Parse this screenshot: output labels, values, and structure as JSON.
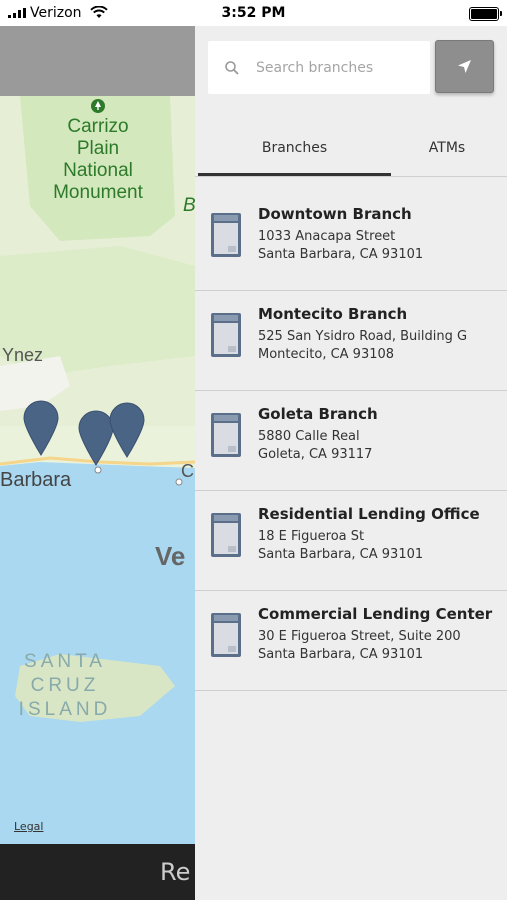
{
  "status_bar": {
    "carrier": "Verizon",
    "time": "3:52 PM"
  },
  "map": {
    "labels": {
      "park": "Carrizo\nPlain\nNational\nMonument",
      "park_edge": "B",
      "ynez": "Ynez",
      "city": "Barbara",
      "city_edge": "C",
      "ve": "Ve",
      "island": "SANTA\nCRUZ\nISLAND"
    },
    "legal": "Legal",
    "bottom_bar_text": "Re"
  },
  "search": {
    "placeholder": "Search branches",
    "value": ""
  },
  "tabs": [
    {
      "label": "Branches",
      "active": true
    },
    {
      "label": "ATMs",
      "active": false
    }
  ],
  "branches": [
    {
      "name": "Downtown Branch",
      "address1": "1033 Anacapa Street",
      "address2": "Santa Barbara, CA 93101"
    },
    {
      "name": "Montecito Branch",
      "address1": "525 San Ysidro Road, Building G",
      "address2": "Montecito, CA 93108"
    },
    {
      "name": "Goleta Branch",
      "address1": "5880 Calle Real",
      "address2": "Goleta, CA 93117"
    },
    {
      "name": "Residential Lending Office",
      "address1": "18 E Figueroa St",
      "address2": "Santa Barbara, CA 93101"
    },
    {
      "name": "Commercial Lending Center",
      "address1": "30 E Figueroa Street, Suite 200",
      "address2": "Santa Barbara, CA 93101"
    }
  ],
  "colors": {
    "map_land": "#e8f0d8",
    "map_park": "#cfe6b8",
    "map_water": "#a9d8f0",
    "panel_bg": "#eeeeee",
    "pin": "#4a6485"
  }
}
